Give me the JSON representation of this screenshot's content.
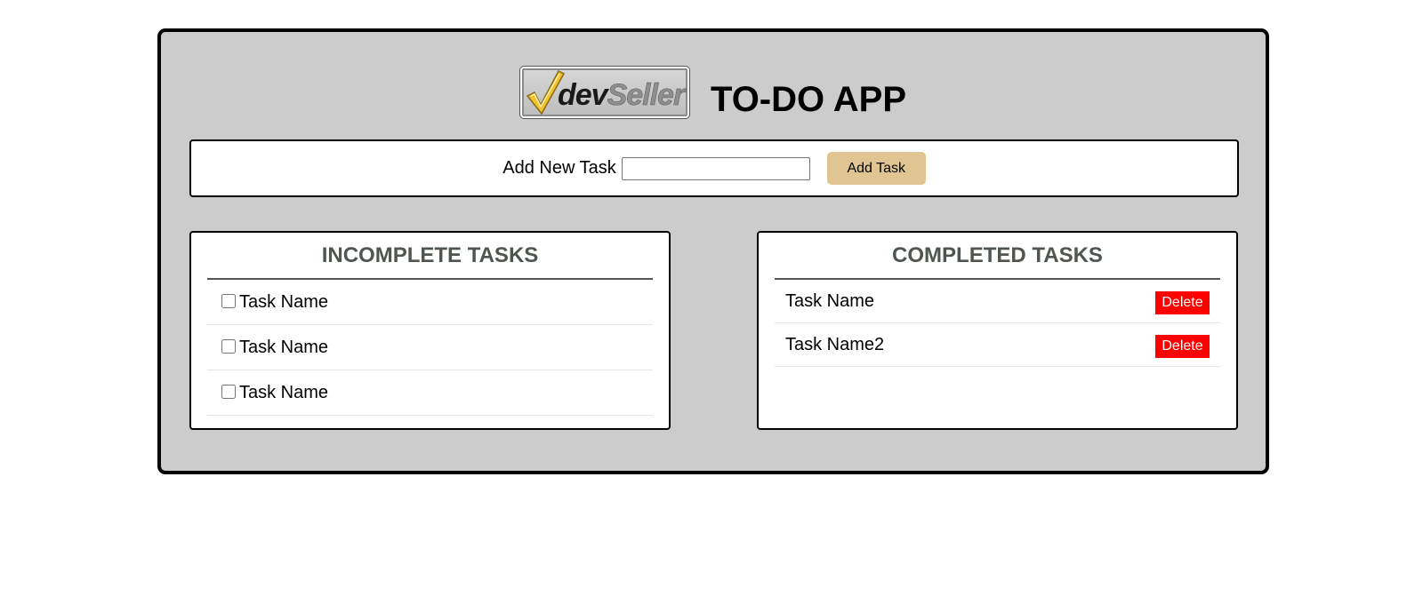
{
  "app": {
    "logo": {
      "text_dev": "dev",
      "text_seller": "Seller"
    },
    "title": "TO-DO APP"
  },
  "add_task": {
    "label": "Add New Task",
    "input_value": "",
    "button_label": "Add Task"
  },
  "incomplete": {
    "heading": "INCOMPLETE TASKS",
    "tasks": [
      {
        "name": "Task Name",
        "checked": false
      },
      {
        "name": "Task Name",
        "checked": false
      },
      {
        "name": "Task Name",
        "checked": false
      }
    ]
  },
  "completed": {
    "heading": "COMPLETED TASKS",
    "delete_label": "Delete",
    "tasks": [
      {
        "name": "Task Name"
      },
      {
        "name": "Task Name2"
      }
    ]
  },
  "colors": {
    "app_background": "#cccccc",
    "add_button": "#e0c592",
    "delete_button": "#ff0000",
    "heading_text": "#4e5650"
  },
  "icons": {
    "logo_checkmark": "checkmark-icon"
  }
}
